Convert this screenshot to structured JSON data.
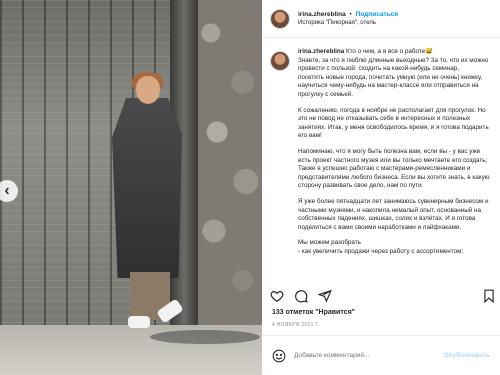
{
  "header": {
    "username": "irina.zhereblina",
    "separator": "•",
    "follow_label": "Подписаться",
    "location": "Историка \"Пикорная\", отель"
  },
  "caption": {
    "username": "irina.zhereblina",
    "paragraphs": [
      [
        "Кто о чем, а я все о работе😅",
        "Знаете, за что я люблю длинные выходные? За то, что их можно",
        "провести с пользой: сходить на какой-нибудь семинар,",
        "посетить новые города, почитать умную (или не очень) книжку,",
        "научиться чему-нибудь на мастер-классе или отправиться на",
        "прогулку с семьей."
      ],
      [
        "К сожалению, погода в ноябре не располагает для прогулок. Но",
        "это не повод не отказывать себе в интересных и полезных",
        "занятиях. Итак, у меня освободилось время, и я готова подарить",
        "его вам!"
      ],
      [
        "Напоминаю, что я могу быть полезна вам, если вы - у вас уже",
        "есть проект частного музея или вы только мечтаете его создать;",
        "Также я успешно работаю с мастерами-ремесленниками и",
        "представителями любого бизнеса. Если вы хотите знать, в какую",
        "сторону развивать свое дело, нам по пути."
      ],
      [
        "Я уже более пятнадцати лет занимаюсь сувенирным бизнесом и",
        "частными музеями, и накопила немалый опыт, основанный на",
        "собственных падениях, шишках, солях и взлётах. И я готова",
        "поделиться с вами своими наработками и лайфхаками."
      ],
      [
        "Мы можем разобрать",
        "- как увеличить продажи через работу с ассортиментом;"
      ]
    ]
  },
  "actions": {
    "like_icon": "heart-icon",
    "comment_icon": "comment-icon",
    "share_icon": "share-icon",
    "save_icon": "bookmark-icon"
  },
  "likes_text": "133 отметок \"Нравится\"",
  "date": "4 НОЯБРЯ 2021 Г.",
  "comment": {
    "placeholder": "Добавьте комментарий...",
    "publish_label": "Опубликовать"
  },
  "colors": {
    "accent": "#0095f6",
    "publish_disabled": "#b3dbff",
    "muted": "#8e8e8e"
  }
}
